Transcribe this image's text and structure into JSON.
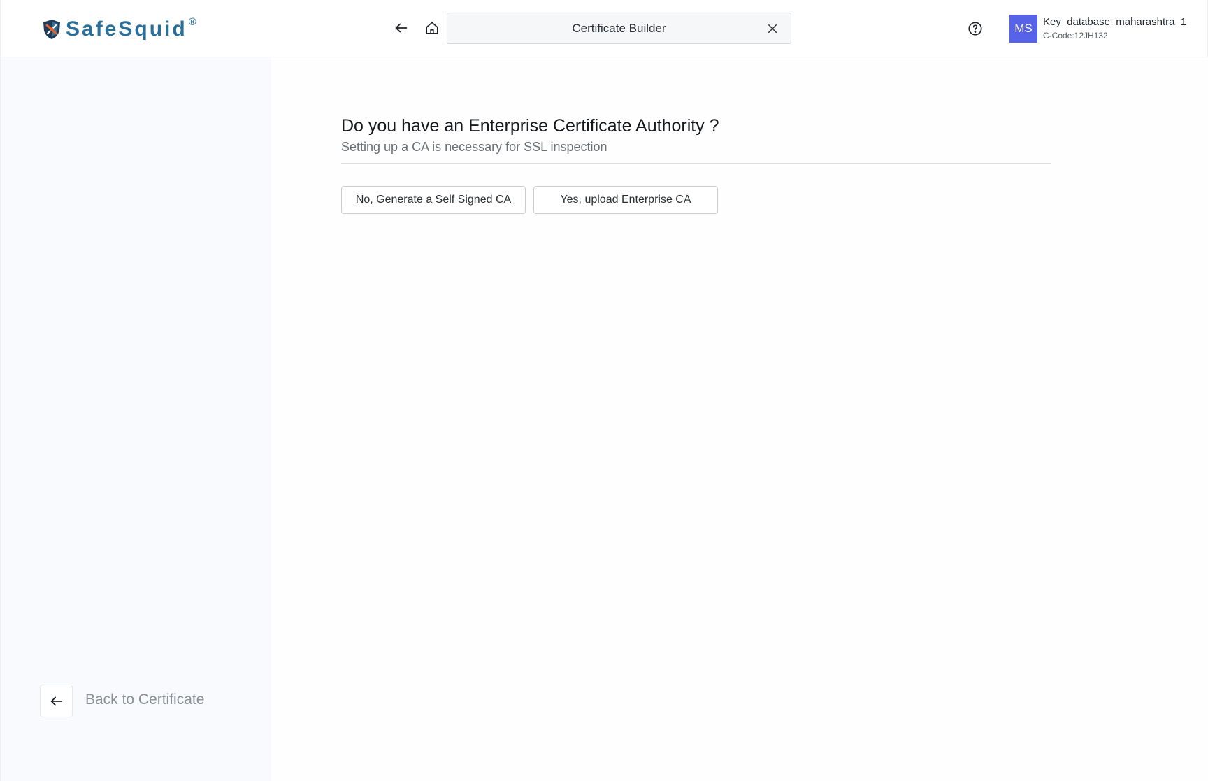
{
  "header": {
    "logo": {
      "text": "SafeSquid",
      "reg_mark": "®"
    },
    "search": {
      "title": "Certificate Builder"
    },
    "user": {
      "initials": "MS",
      "name": "Key_database_maharashtra_1",
      "code": "C-Code:12JH132",
      "avatar_color": "#5662e8"
    },
    "icons": [
      "arrow-left-icon",
      "home-icon",
      "close-icon",
      "help-circle-icon"
    ]
  },
  "sidebar": {
    "back_label": "Back to Certificate"
  },
  "main": {
    "question": "Do you have an Enterprise Certificate Authority ?",
    "subtext": "Setting up a CA is necessary for SSL inspection",
    "options": [
      {
        "label": "No, Generate a Self Signed CA"
      },
      {
        "label": "Yes, upload Enterprise CA"
      }
    ]
  },
  "colors": {
    "brand": "#2a6f97",
    "sidebar_bg": "#f9fafd"
  }
}
